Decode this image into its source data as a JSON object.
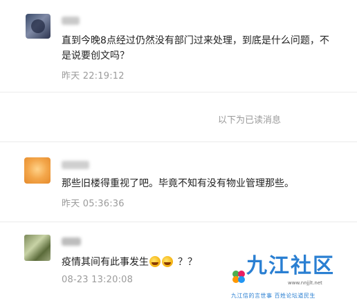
{
  "comments": [
    {
      "text_line1": "直到今晚8点经过仍然没有部门过来处理，到底是什么问题，不",
      "text_line2": "是说要创文吗？",
      "time": "昨天 22:19:12"
    },
    {
      "text": "那些旧楼得重视了吧。毕竟不知有没有物业管理那些。",
      "time": "昨天 05:36:36"
    },
    {
      "text": "疫情其间有此事发生",
      "text_suffix": "？？",
      "time": "08-23 13:20:08"
    }
  ],
  "read_separator": "以下为已读消息",
  "watermark": {
    "title": "九江社区",
    "url": "www.nnjjlt.net",
    "slogan": "九江信的言世事  百姓论坛道民生"
  },
  "colors": {
    "text": "#222222",
    "meta": "#9b9b9b",
    "divider": "#ebebeb",
    "watermark_blue": "#2a7fd2"
  }
}
